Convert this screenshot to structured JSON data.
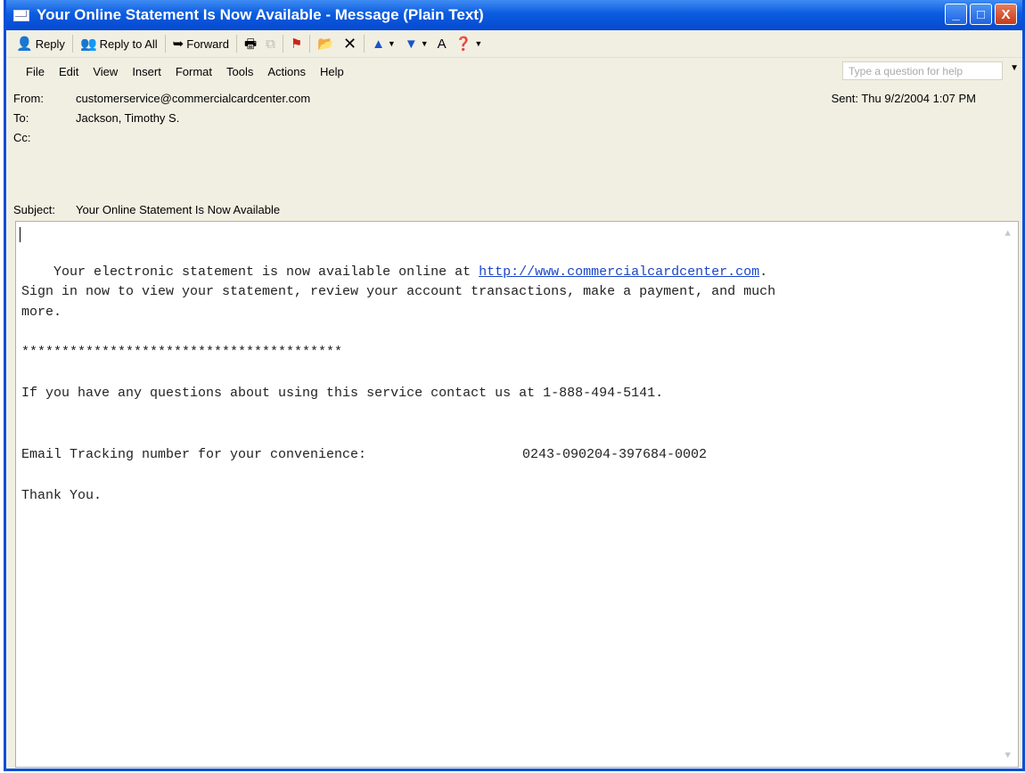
{
  "window": {
    "title": "Your Online Statement Is Now Available - Message (Plain Text)",
    "minimize": "_",
    "maximize": "□",
    "close": "X"
  },
  "toolbar": {
    "reply": "Reply",
    "reply_all": "Reply to All",
    "forward": "Forward"
  },
  "menu": {
    "items": [
      "File",
      "Edit",
      "View",
      "Insert",
      "Format",
      "Tools",
      "Actions",
      "Help"
    ],
    "help_placeholder": "Type a question for help"
  },
  "header": {
    "from_label": "From:",
    "from": "customerservice@commercialcardcenter.com",
    "to_label": "To:",
    "to": "Jackson, Timothy S.",
    "cc_label": "Cc:",
    "cc": "",
    "subject_label": "Subject:",
    "subject": "Your Online Statement Is Now Available",
    "sent": "Sent: Thu 9/2/2004 1:07 PM"
  },
  "body": {
    "line1_pre": "    Your electronic statement is now available online at ",
    "link": "http://www.commercialcardcenter.com",
    "line1_post": ".",
    "line2": "Sign in now to view your statement, review your account transactions, make a payment, and much",
    "line3": "more.",
    "stars": "****************************************",
    "questions": "If you have any questions about using this service contact us at 1-888-494-5141.",
    "tracking_label": "Email Tracking number for your convenience:",
    "tracking_number": "0243-090204-397684-0002",
    "thanks": "Thank You."
  },
  "colors": {
    "titlebar": "#0b5ce0",
    "link": "#1a45c9",
    "chrome": "#f1efe2"
  }
}
